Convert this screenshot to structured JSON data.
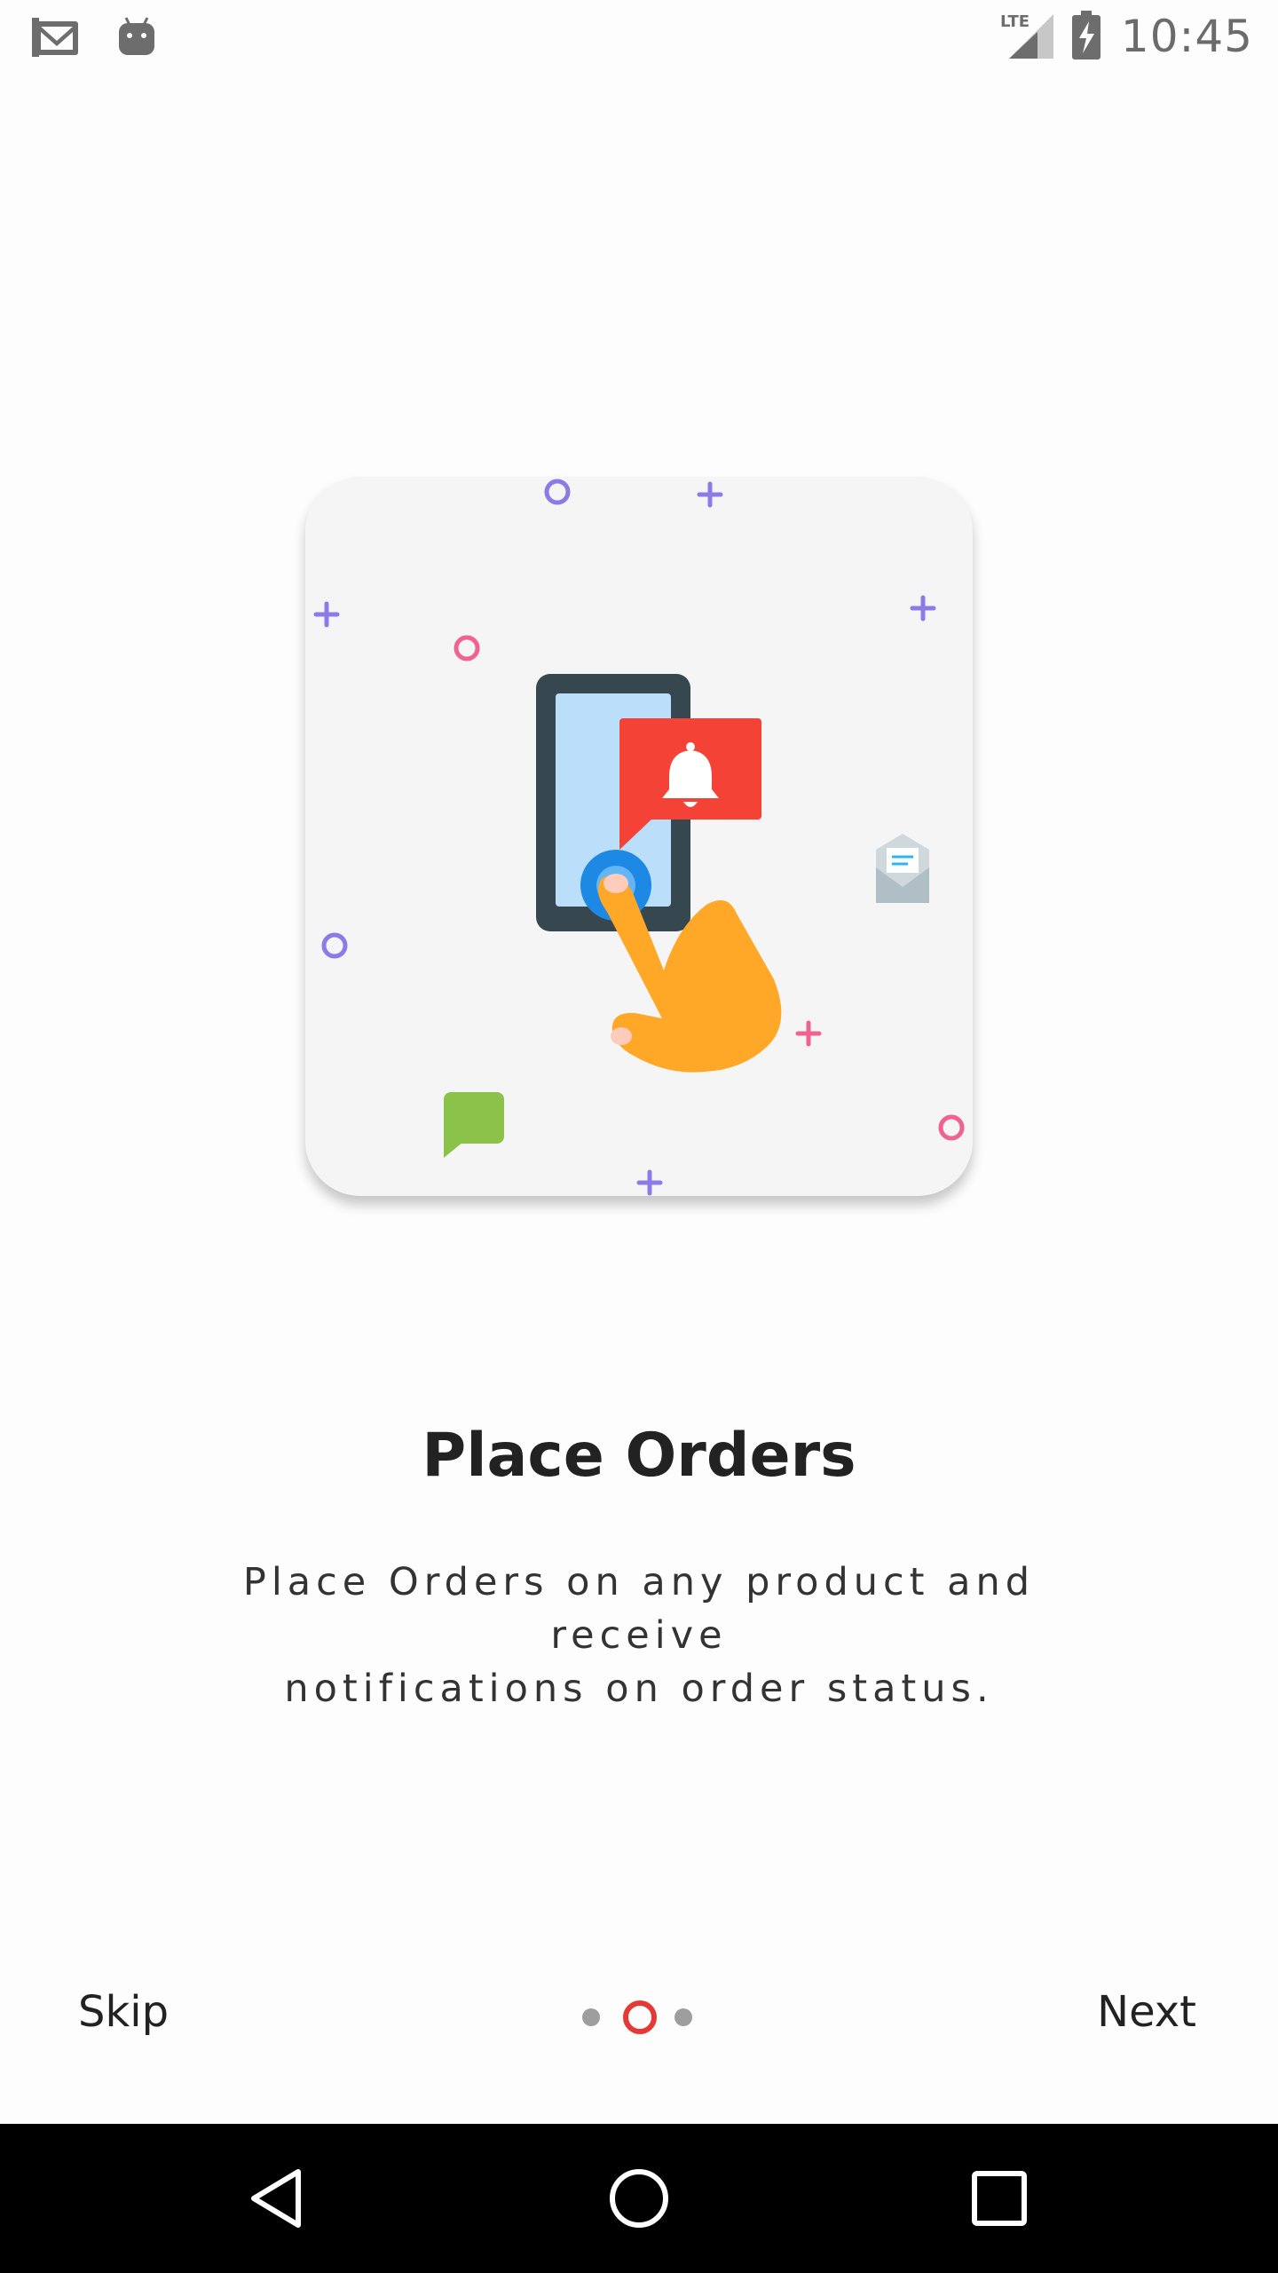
{
  "status_bar": {
    "time": "10:45",
    "network": "LTE",
    "left_icons": [
      "gmail-icon",
      "android-icon"
    ],
    "right_icons": [
      "signal-icon",
      "battery-charging-icon"
    ]
  },
  "onboarding": {
    "illustration": "phone-notification-illustration",
    "title": "Place Orders",
    "description_line1": "Place Orders on any product and receive",
    "description_line2": "notifications on order status."
  },
  "controls": {
    "skip_label": "Skip",
    "next_label": "Next",
    "page_indicator": {
      "total": 3,
      "current": 2
    }
  },
  "nav_bar": {
    "items": [
      "back-icon",
      "home-icon",
      "recents-icon"
    ]
  },
  "colors": {
    "accent": "#e53935",
    "dot_inactive": "#9e9e9e",
    "card_bg": "#f5f5f5",
    "title": "#222222"
  }
}
